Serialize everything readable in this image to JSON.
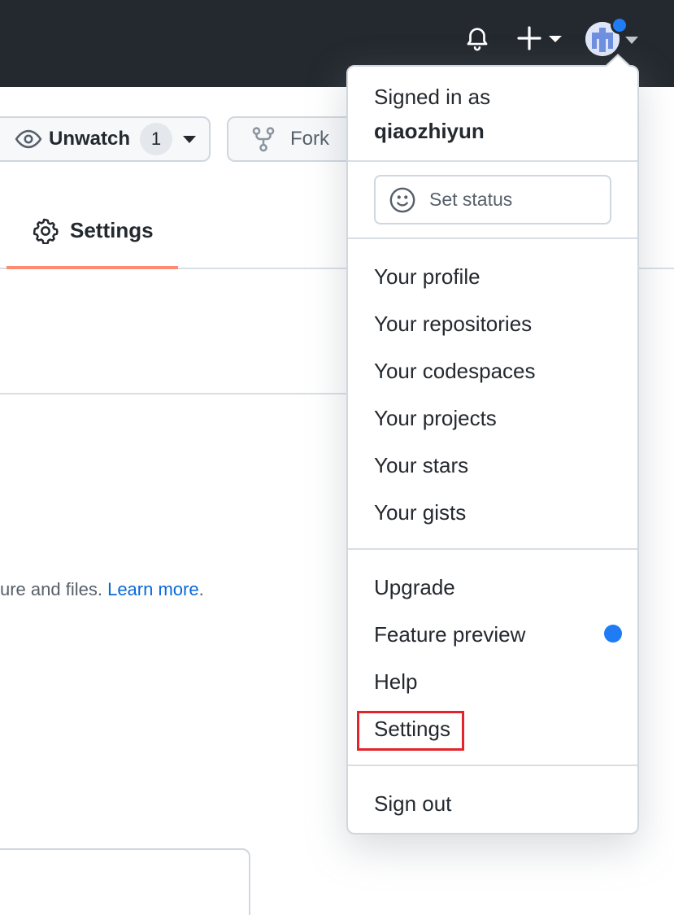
{
  "header": {
    "bell_icon": "bell-icon",
    "plus_icon": "plus-icon",
    "avatar_icon": "avatar",
    "notification_color": "#1f7cf5"
  },
  "repo_actions": {
    "unwatch_label": "Unwatch",
    "unwatch_count": "1",
    "fork_label": "Fork"
  },
  "tab": {
    "settings_label": "Settings",
    "active_underline_color": "#fd8c73"
  },
  "content": {
    "desc_text": "ure and files. ",
    "learn_more": "Learn more",
    "desc_end": "."
  },
  "dropdown": {
    "signed_in_as": "Signed in as",
    "username": "qiaozhiyun",
    "set_status": "Set status",
    "group1": [
      "Your profile",
      "Your repositories",
      "Your codespaces",
      "Your projects",
      "Your stars",
      "Your gists"
    ],
    "group2": [
      "Upgrade",
      "Feature preview",
      "Help",
      "Settings"
    ],
    "sign_out": "Sign out",
    "highlight_color": "#e3242b"
  }
}
